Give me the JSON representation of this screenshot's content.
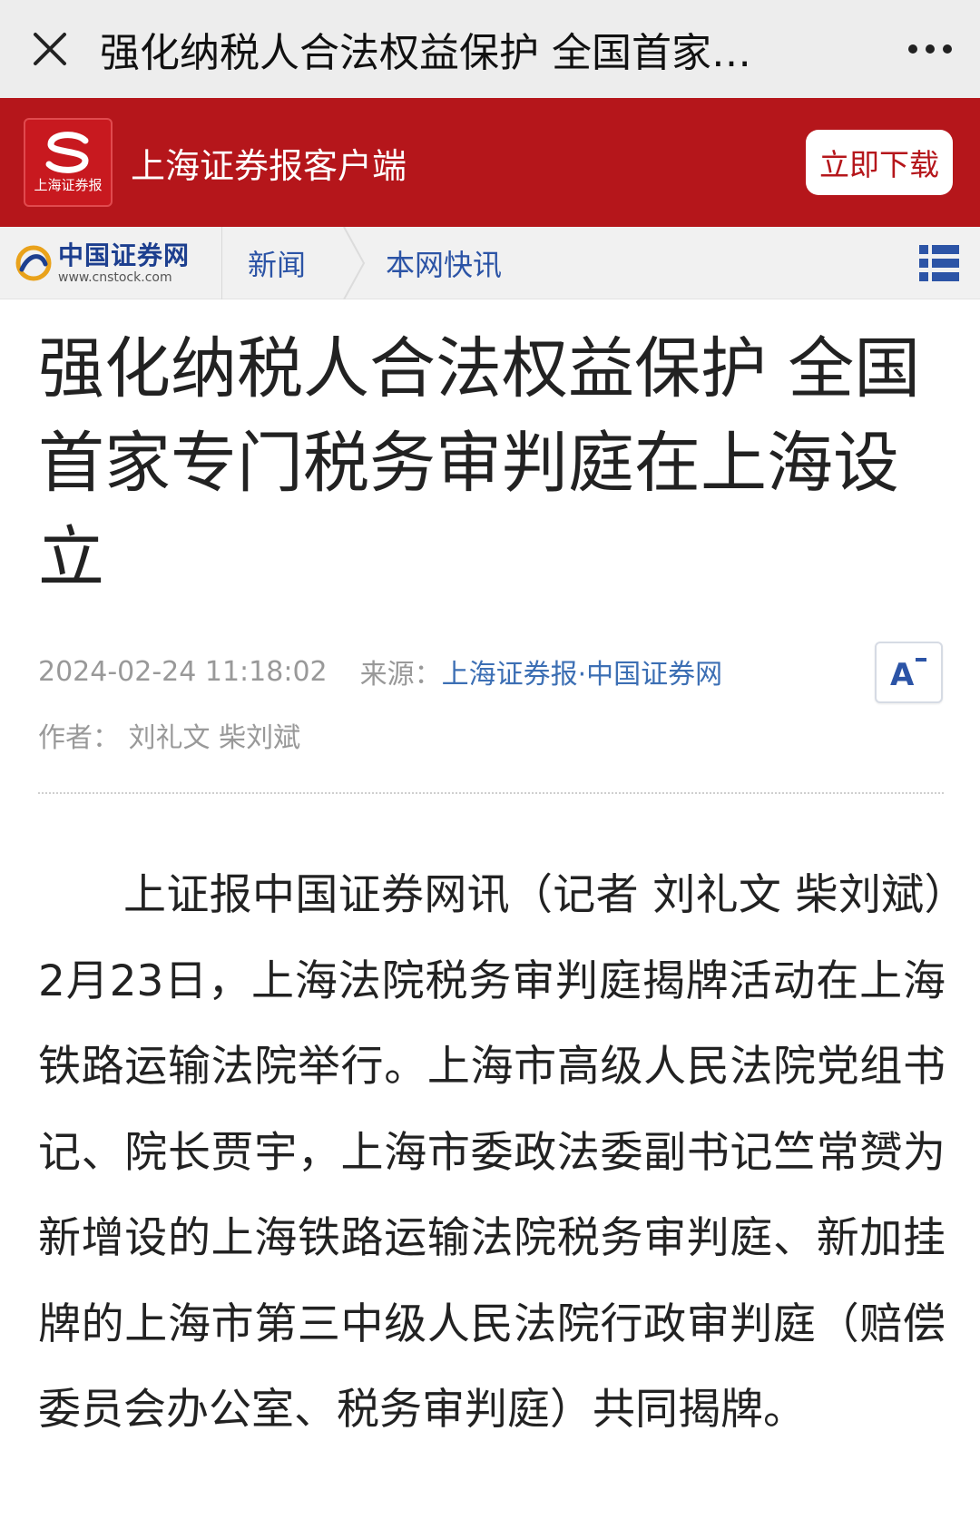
{
  "topbar": {
    "title": "强化纳税人合法权益保护 全国首家…",
    "close_icon": "close-icon",
    "more_icon": "more-dots-icon"
  },
  "appbar": {
    "logo_text": "上海证券报",
    "app_name": "上海证券报客户端",
    "download_label": "立即下载",
    "brand_color": "#b5161b"
  },
  "sitenav": {
    "site_name": "中国证券网",
    "site_url": "www.cnstock.com",
    "crumb_news": "新闻",
    "crumb_flash": "本网快讯",
    "link_color": "#2c54a6"
  },
  "article": {
    "headline": "强化纳税人合法权益保护 全国首家专门税务审判庭在上海设立",
    "date": "2024-02-24 11:18:02",
    "source_label": "来源：",
    "source": "上海证券报·中国证券网",
    "author_line": "作者：  刘礼文 柴刘斌",
    "body": "上证报中国证券网讯（记者 刘礼文 柴刘斌）2月23日，上海法院税务审判庭揭牌活动在上海铁路运输法院举行。上海市高级人民法院党组书记、院长贾宇，上海市委政法委副书记竺常赟为新增设的上海铁路运输法院税务审判庭、新加挂牌的上海市第三中级人民法院行政审判庭（赔偿委员会办公室、税务审判庭）共同揭牌。"
  }
}
